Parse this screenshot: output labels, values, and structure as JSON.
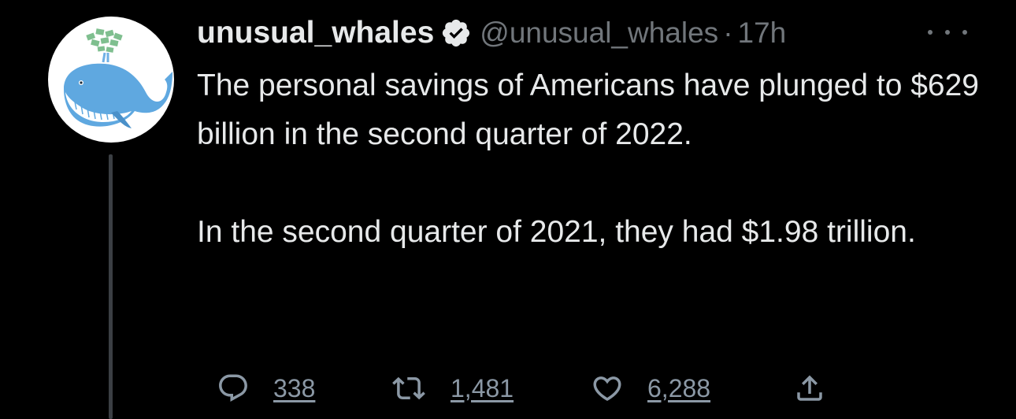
{
  "tweet": {
    "author": {
      "display_name": "unusual_whales",
      "handle": "@unusual_whales",
      "verified": true,
      "avatar_icon": "whale-icon"
    },
    "separator": "·",
    "time": "17h",
    "text_paragraphs": [
      "The personal savings of Americans have plunged to $629 billion in the second quarter of 2022.",
      "In the second quarter of 2021, they had $1.98 trillion."
    ],
    "actions": {
      "reply_count": "338",
      "retweet_count": "1,481",
      "like_count": "6,288"
    }
  },
  "icons": {
    "more": "more-horizontal-icon",
    "reply": "reply-icon",
    "retweet": "retweet-icon",
    "like": "heart-icon",
    "share": "share-icon",
    "verified": "verified-badge-icon"
  },
  "colors": {
    "background": "#000000",
    "primary_text": "#e7e9ea",
    "secondary_text": "#71767b",
    "action_text": "#8b98a5",
    "whale_blue": "#5fa8e0",
    "money_green": "#7fbf8f"
  }
}
